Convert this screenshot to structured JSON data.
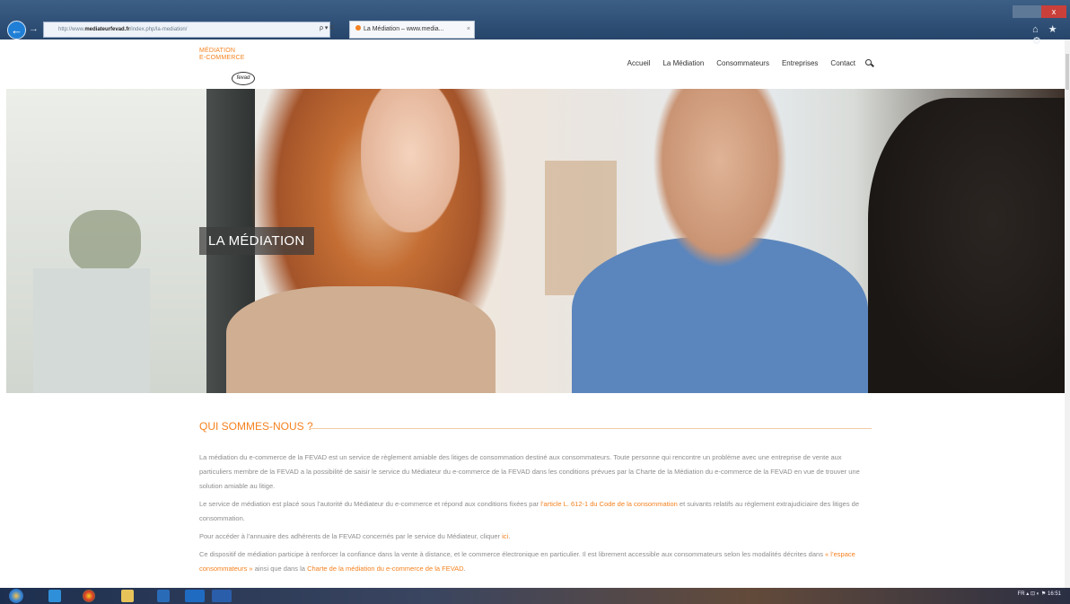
{
  "browser": {
    "url_prefix": "http://www.",
    "url_host": "mediateurfevad.fr",
    "url_path": "/index.php/la-mediation/",
    "address_controls": "ρ ▾ C",
    "tab_title": "La Médiation – www.media...",
    "tab_close": "×",
    "back_arrow": "←",
    "forward_arrow": "→",
    "close_glyph": "x",
    "tools": "⌂ ★ ⚙"
  },
  "site": {
    "logo_line1": "MÉDIATION",
    "logo_line2": "E-COMMERCE",
    "logo_badge": "fevad",
    "menu": [
      "Accueil",
      "La Médiation",
      "Consommateurs",
      "Entreprises",
      "Contact"
    ]
  },
  "hero": {
    "title": "LA MÉDIATION"
  },
  "section": {
    "title": "QUI SOMMES-NOUS ?",
    "p1": "La médiation du e-commerce de la FEVAD est un service de règlement amiable des litiges de consommation destiné aux consommateurs. Toute personne qui rencontre un problème avec une entreprise de vente aux particuliers membre de la FEVAD a la possibilité de saisir le service du Médiateur du e-commerce de la FEVAD dans les conditions prévues par la Charte de la Médiation du e-commerce de la FEVAD en vue de trouver une solution amiable au litige.",
    "p2_before": "Le service de médiation est placé sous l’autorité du Médiateur du e-commerce et répond aux conditions fixées par ",
    "p2_link": "l’article L. 612-1 du Code de la consommation",
    "p2_after": " et suivants relatifs au règlement extrajudiciaire des litiges de consommation.",
    "p3_before": "Pour accéder à l’annuaire des adhérents de la FEVAD concernés par le service du Médiateur, cliquer ",
    "p3_link": "ici",
    "p3_after": ".",
    "p4_before": "Ce dispositif de médiation participe à renforcer la confiance dans la vente à distance, et le commerce électronique en particulier. Il est librement accessible aux consommateurs selon les modalités décrites dans ",
    "p4_link1": "« l’espace consommateurs »",
    "p4_mid": " ainsi que dans la ",
    "p4_link2": "Charte de la médiation du e-commerce de la FEVAD",
    "p4_after": "."
  },
  "taskbar": {
    "tray_text": "FR  ▴  ⊡  ◐  ⚑",
    "clock": "16:51"
  },
  "colors": {
    "accent": "#f58220",
    "text_gray": "#8d8d8d"
  }
}
